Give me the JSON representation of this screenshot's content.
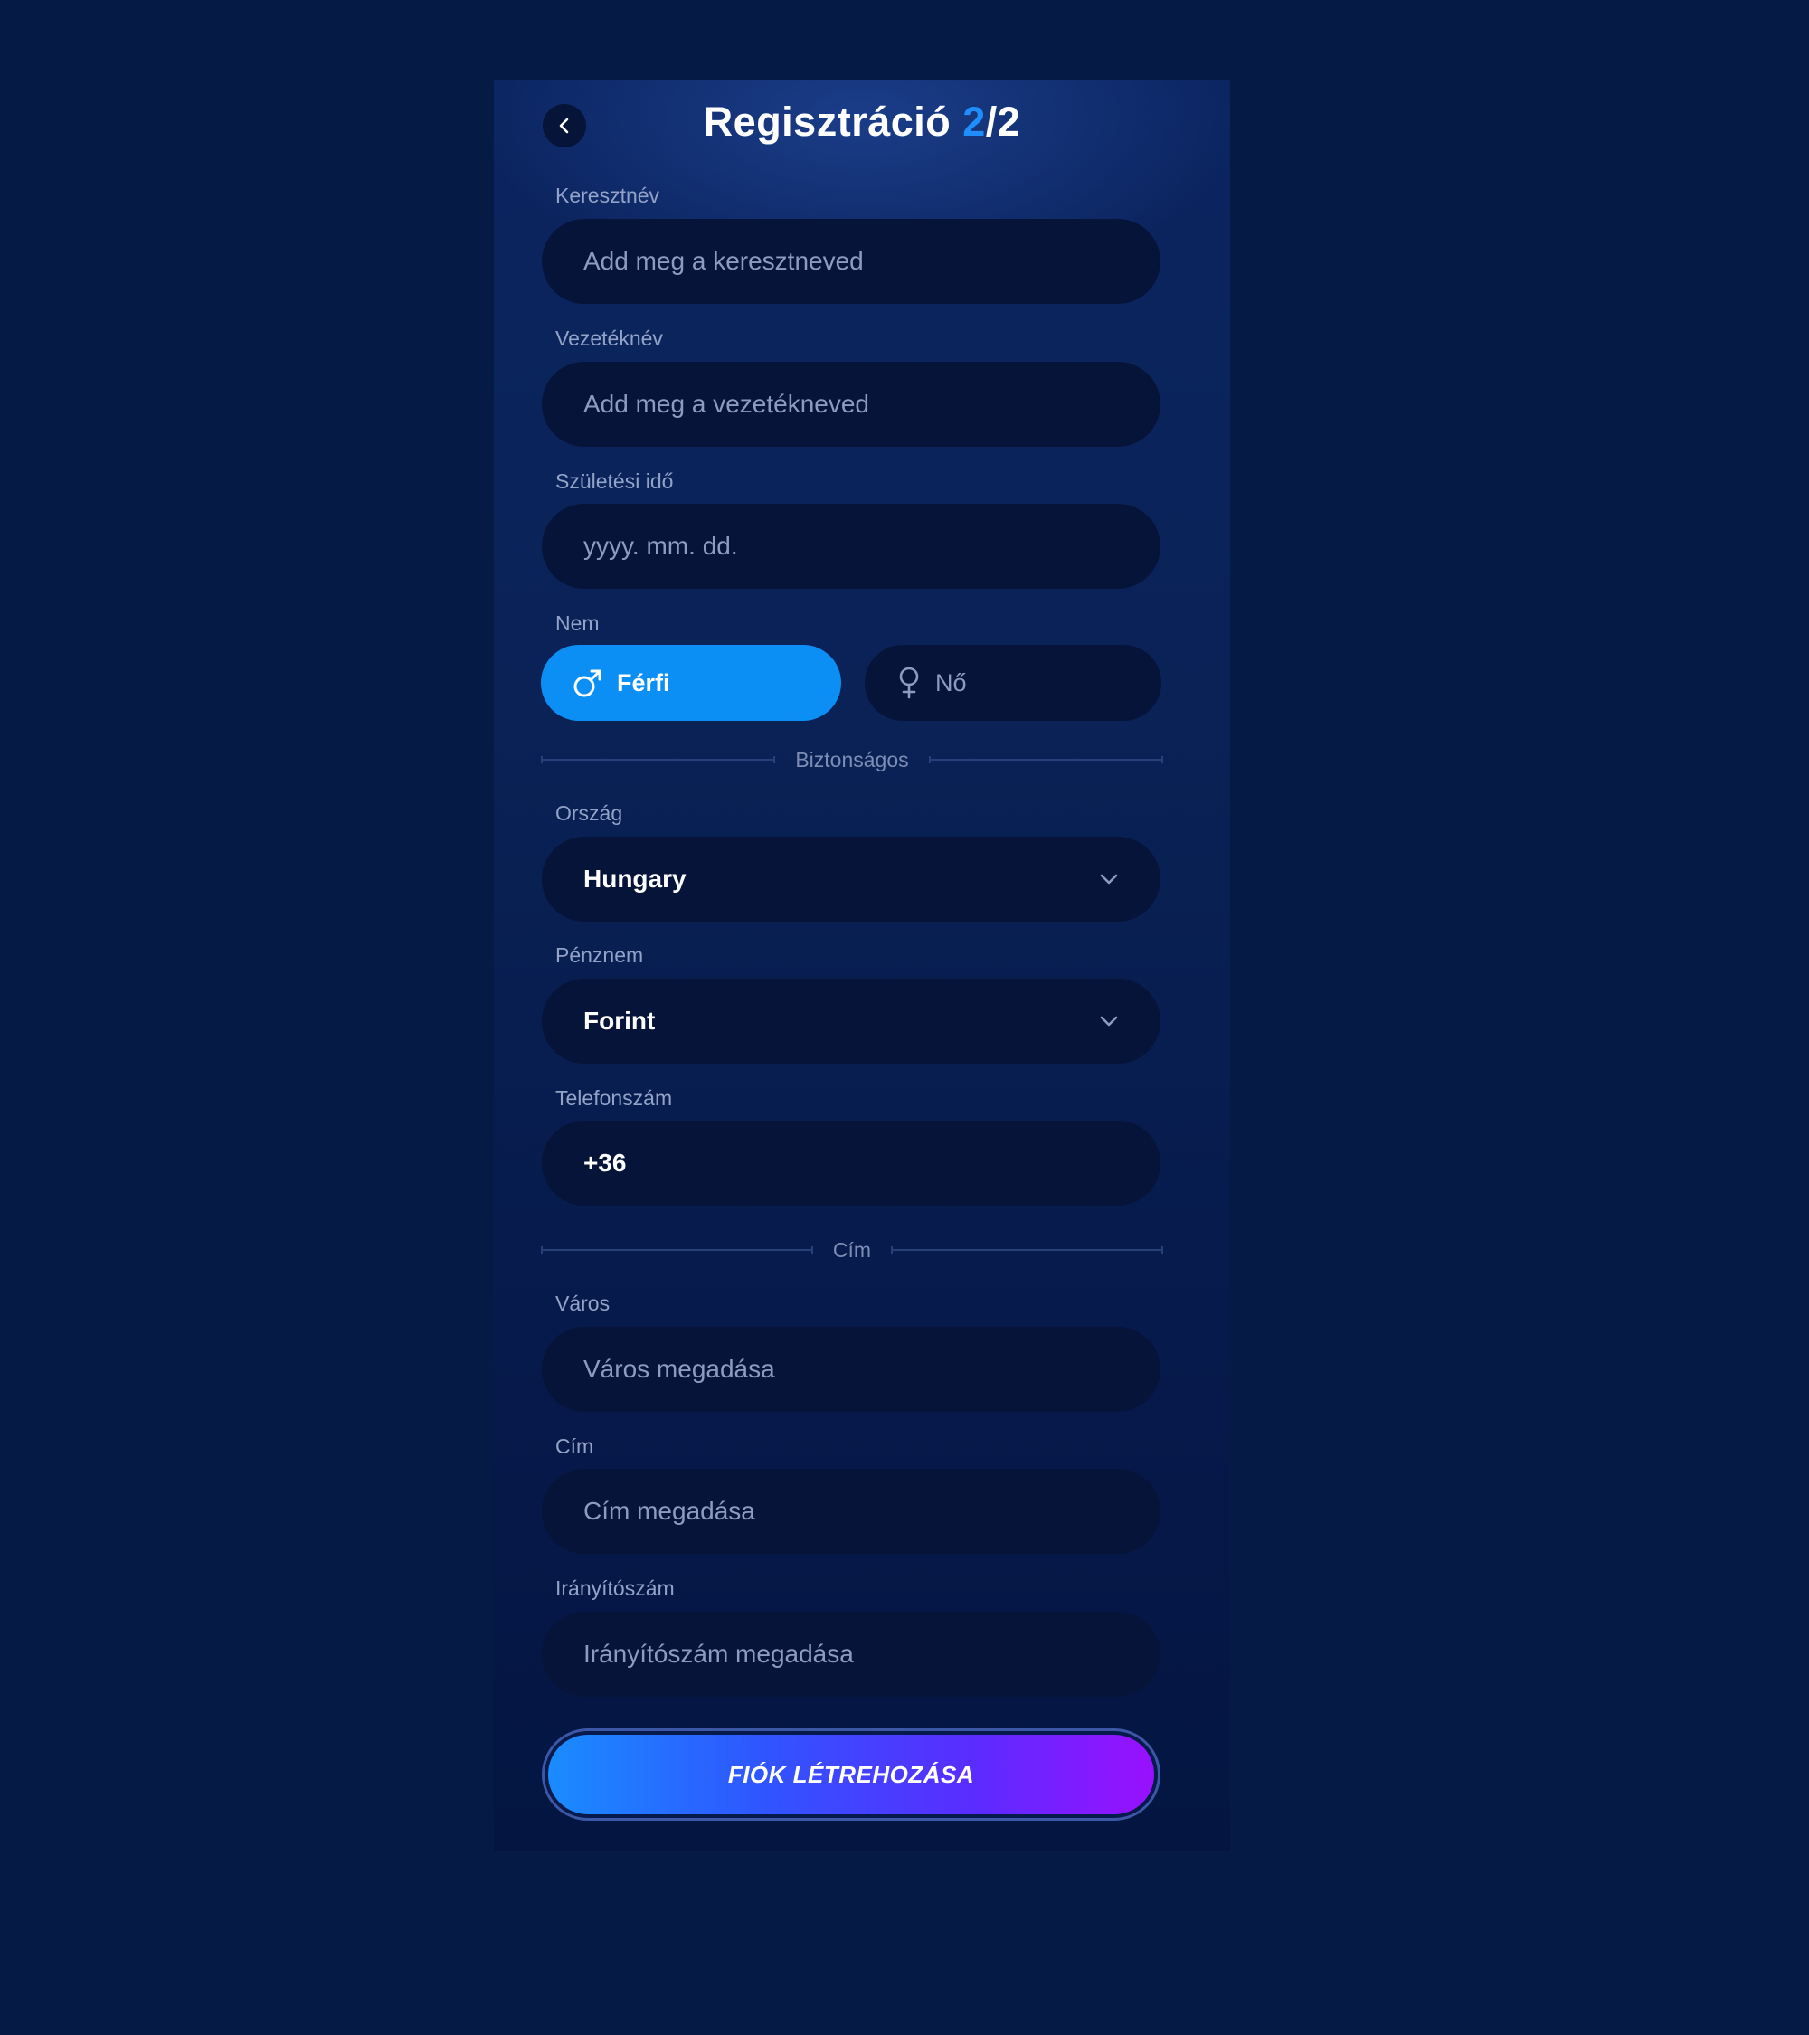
{
  "header": {
    "title_prefix": "Regisztráció ",
    "step_current": "2",
    "step_total": "/2"
  },
  "form": {
    "first_name": {
      "label": "Keresztnév",
      "placeholder": "Add meg a keresztneved"
    },
    "last_name": {
      "label": "Vezetéknév",
      "placeholder": "Add meg a vezetékneved"
    },
    "birth_date": {
      "label": "Születési idő",
      "placeholder": "yyyy. mm. dd."
    },
    "gender": {
      "label": "Nem",
      "male": "Férfi",
      "female": "Nő",
      "selected": "Férfi"
    },
    "security_divider": "Biztonságos",
    "country": {
      "label": "Ország",
      "value": "Hungary"
    },
    "currency": {
      "label": "Pénznem",
      "value": "Forint"
    },
    "phone": {
      "label": "Telefonszám",
      "value": "+36"
    },
    "address_divider": "Cím",
    "city": {
      "label": "Város",
      "placeholder": "Város megadása"
    },
    "address": {
      "label": "Cím",
      "placeholder": "Cím megadása"
    },
    "zip": {
      "label": "Irányítószám",
      "placeholder": "Irányítószám megadása"
    },
    "submit_label": "FIÓK LÉTREHOZÁSA"
  },
  "colors": {
    "page_bg": "#051a45",
    "field_bg": "#06143a",
    "accent": "#0c8ff4",
    "step_accent": "#1f8dfb"
  },
  "icons": {
    "back": "chevron-left-icon",
    "male": "male-symbol-icon",
    "female": "female-symbol-icon",
    "dropdown": "chevron-down-icon"
  }
}
